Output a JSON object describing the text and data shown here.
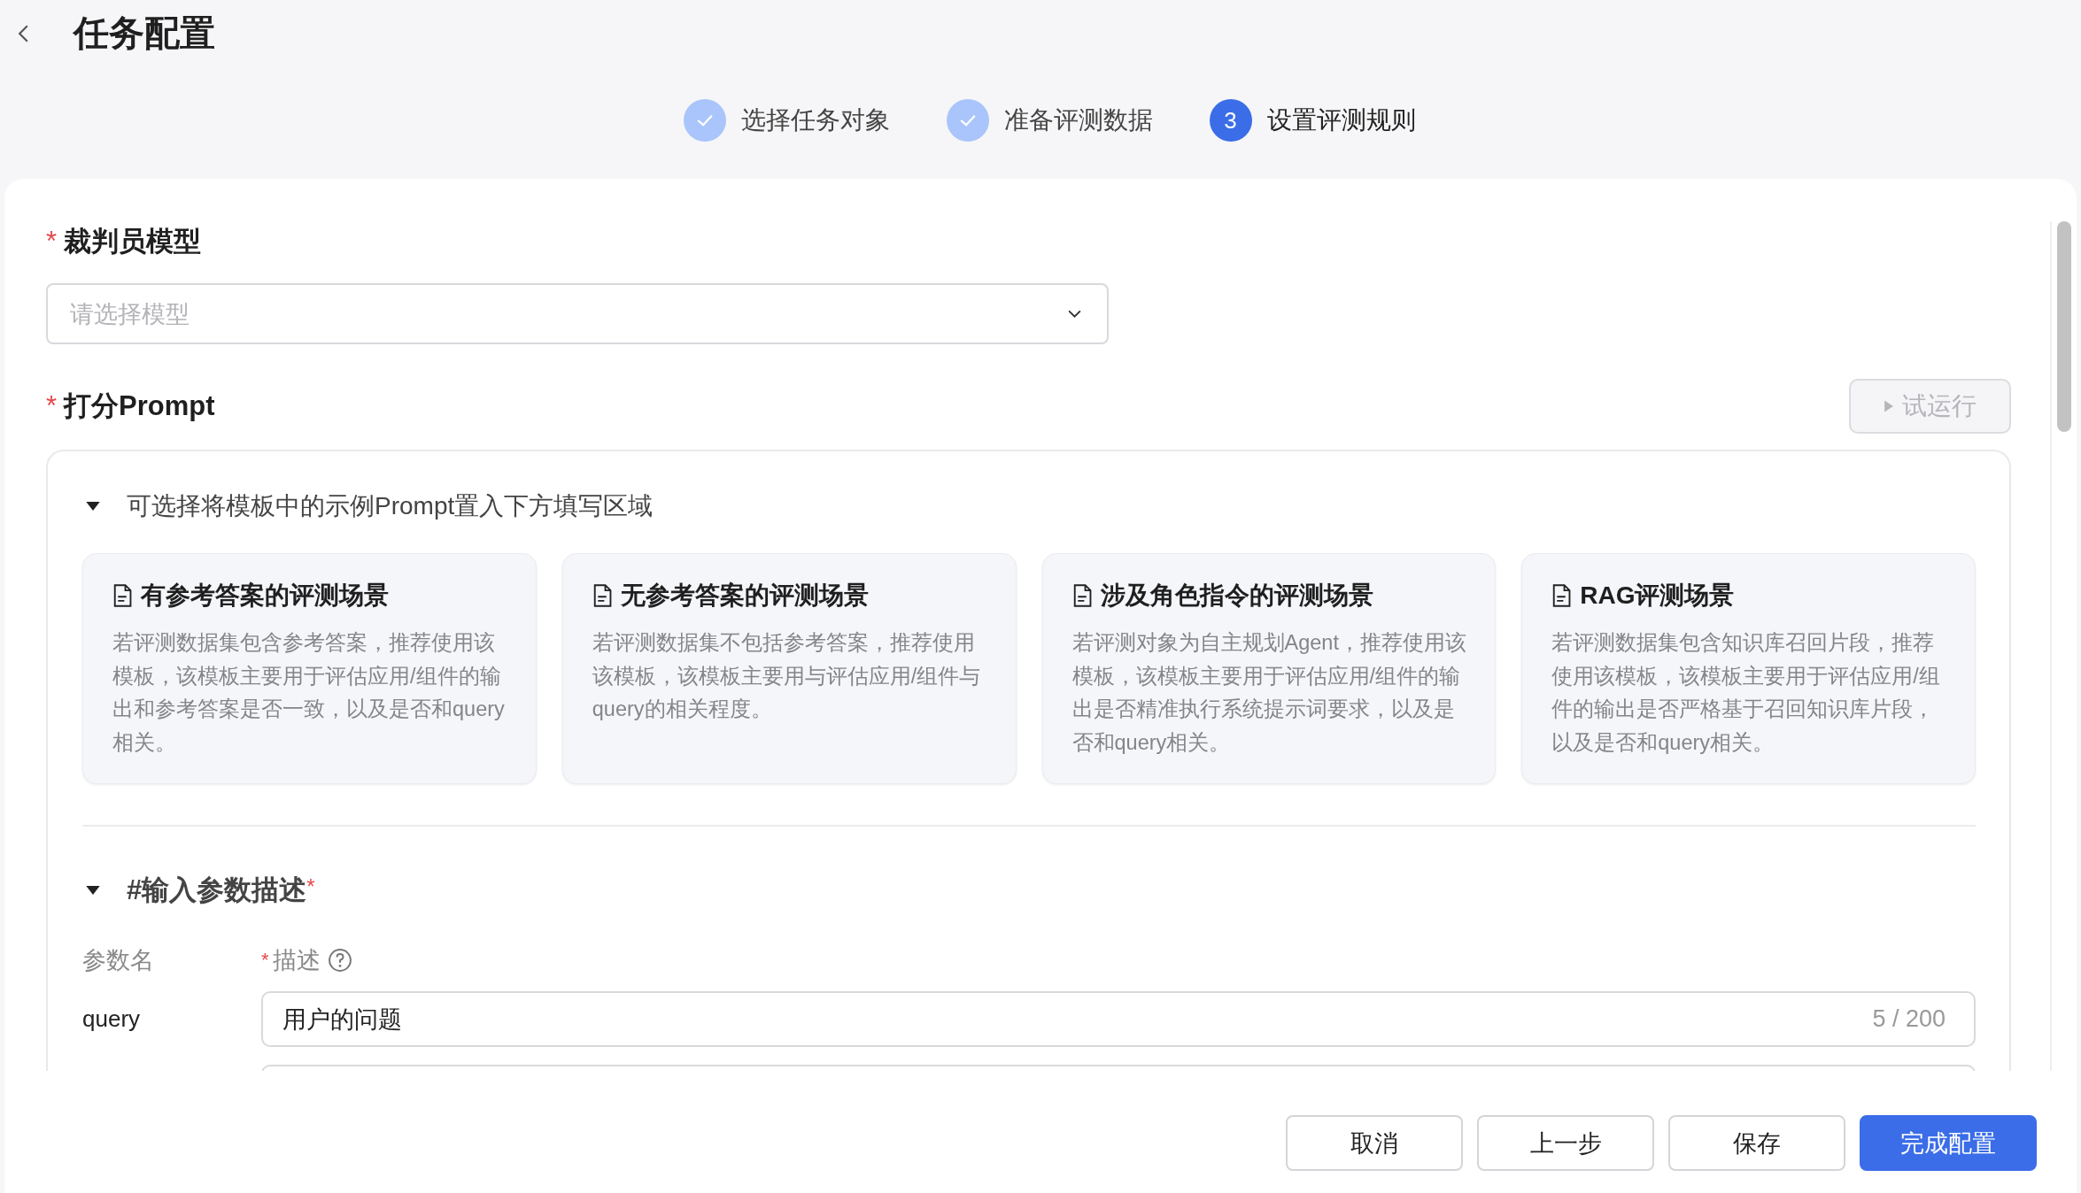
{
  "header": {
    "title": "任务配置"
  },
  "steps": [
    {
      "label": "选择任务对象",
      "completed": true,
      "selected": false
    },
    {
      "label": "准备评测数据",
      "completed": true,
      "selected": false
    },
    {
      "label": "设置评测规则",
      "completed": false,
      "selected": true,
      "number": "3"
    }
  ],
  "judge_model": {
    "required_mark": "*",
    "label": "裁判员模型",
    "select": {
      "placeholder": "请选择模型"
    }
  },
  "scoring_prompt": {
    "required_mark": "*",
    "label": "打分Prompt",
    "trial_button": {
      "label": "试运行",
      "disabled": true
    },
    "templates": {
      "title": "可选择将模板中的示例Prompt置入下方填写区域",
      "expanded": true,
      "cards": [
        {
          "title": "有参考答案的评测场景",
          "description": "若评测数据集包含参考答案，推荐使用该模板，该模板主要用于评估应用/组件的输出和参考答案是否一致，以及是否和query相关。"
        },
        {
          "title": "无参考答案的评测场景",
          "description": "若评测数据集不包括参考答案，推荐使用该模板，该模板主要用与评估应用/组件与query的相关程度。"
        },
        {
          "title": "涉及角色指令的评测场景",
          "description": "若评测对象为自主规划Agent，推荐使用该模板，该模板主要用于评估应用/组件的输出是否精准执行系统提示词要求，以及是否和query相关。"
        },
        {
          "title": "RAG评测场景",
          "description": "若评测数据集包含知识库召回片段，推荐使用该模板，该模板主要用于评估应用/组件的输出是否严格基于召回知识库片段，以及是否和query相关。"
        }
      ]
    },
    "params": {
      "title": "#输入参数描述",
      "required_mark": "*",
      "expanded": true,
      "columns": [
        {
          "label": "参数名"
        },
        {
          "label": "描述",
          "required_mark": "*"
        }
      ],
      "rows": [
        {
          "name": "query",
          "value": "用户的问题",
          "counter": "5 / 200"
        }
      ]
    }
  },
  "footer": {
    "buttons": [
      {
        "label": "取消",
        "kind": "default"
      },
      {
        "label": "上一步",
        "kind": "default"
      },
      {
        "label": "保存",
        "kind": "default"
      },
      {
        "label": "完成配置",
        "kind": "primary"
      }
    ]
  }
}
